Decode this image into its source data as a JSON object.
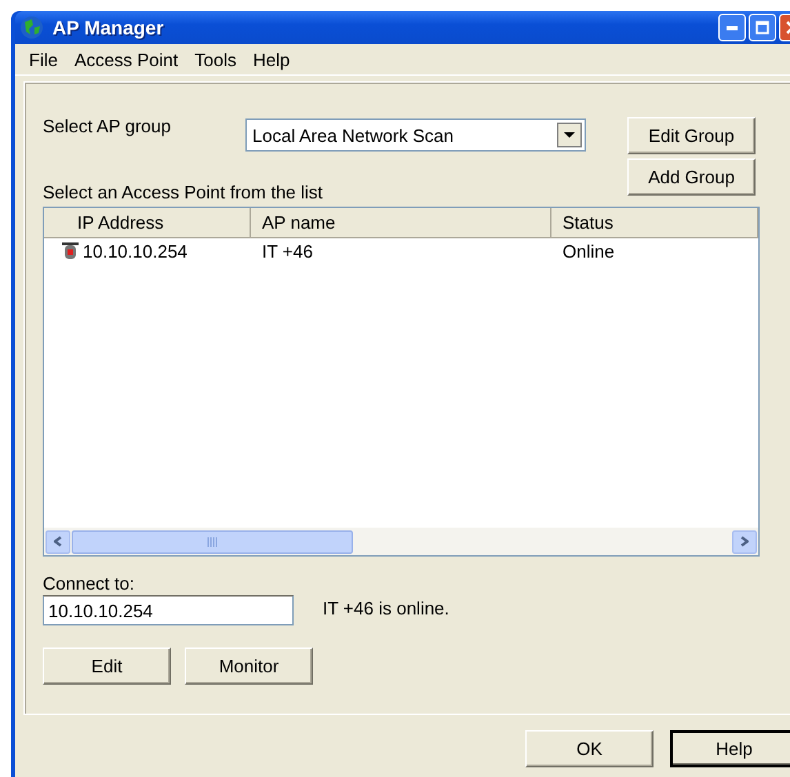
{
  "window": {
    "title": "AP Manager"
  },
  "menu": [
    "File",
    "Access Point",
    "Tools",
    "Help"
  ],
  "group": {
    "label": "Select AP group",
    "value": "Local Area Network Scan"
  },
  "group_buttons": [
    "Edit Group",
    "Add Group"
  ],
  "list_label": "Select an Access Point from the list",
  "table": {
    "columns": [
      "IP Address",
      "AP name",
      "Status"
    ],
    "rows": [
      {
        "cells": [
          "10.10.10.254",
          "IT +46",
          "Online"
        ],
        "selected": false
      }
    ]
  },
  "connect": {
    "label": "Connect to:",
    "value": "10.10.10.254",
    "status": "IT +46 is online."
  },
  "action_buttons": [
    "Edit",
    "Monitor"
  ],
  "dialog_buttons": [
    {
      "label": "OK",
      "default": false
    },
    {
      "label": "Help",
      "default": true
    }
  ]
}
